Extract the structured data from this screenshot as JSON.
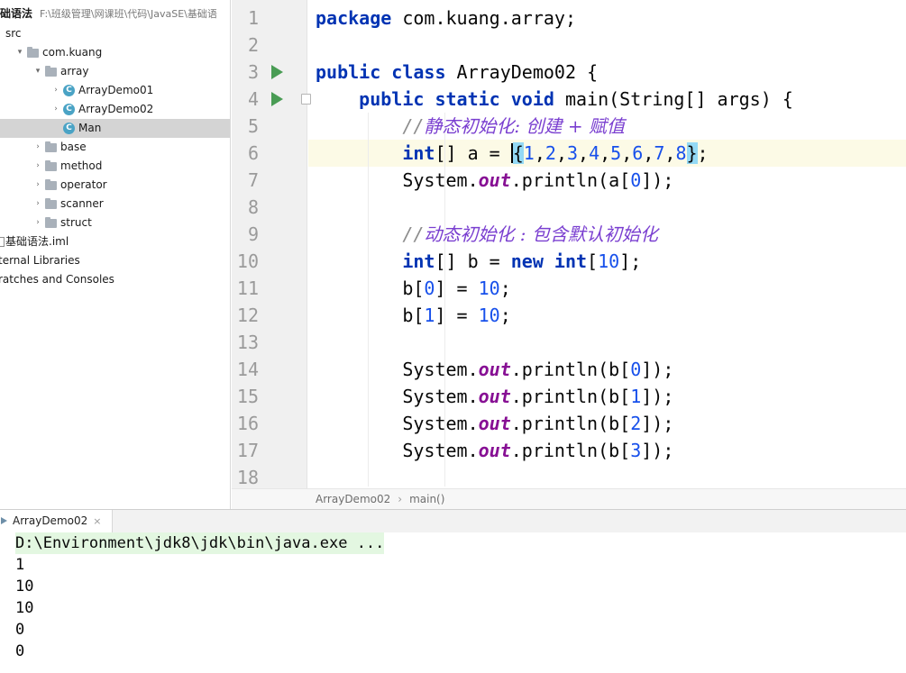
{
  "project": {
    "root_name": "础语法",
    "root_path": "F:\\班级管理\\网课班\\代码\\JavaSE\\基础语",
    "items": [
      {
        "label": "src",
        "type": "folder",
        "depth": 0,
        "expanded": true,
        "selected": false
      },
      {
        "label": "com.kuang",
        "type": "package",
        "depth": 1,
        "expanded": true,
        "selected": false
      },
      {
        "label": "array",
        "type": "package",
        "depth": 2,
        "expanded": true,
        "selected": false
      },
      {
        "label": "ArrayDemo01",
        "type": "class",
        "depth": 3,
        "expanded": false,
        "selected": false
      },
      {
        "label": "ArrayDemo02",
        "type": "class",
        "depth": 3,
        "expanded": false,
        "selected": false
      },
      {
        "label": "Man",
        "type": "class",
        "depth": 3,
        "expanded": false,
        "selected": true
      },
      {
        "label": "base",
        "type": "package",
        "depth": 2,
        "expanded": false,
        "selected": false
      },
      {
        "label": "method",
        "type": "package",
        "depth": 2,
        "expanded": false,
        "selected": false
      },
      {
        "label": "operator",
        "type": "package",
        "depth": 2,
        "expanded": false,
        "selected": false
      },
      {
        "label": "scanner",
        "type": "package",
        "depth": 2,
        "expanded": false,
        "selected": false
      },
      {
        "label": "struct",
        "type": "package",
        "depth": 2,
        "expanded": false,
        "selected": false
      },
      {
        "label": "基础语法.iml",
        "type": "iml",
        "depth": 0,
        "expanded": false,
        "selected": false
      },
      {
        "label": "ternal Libraries",
        "type": "node",
        "depth": 0,
        "expanded": false,
        "selected": false
      },
      {
        "label": "ratches and Consoles",
        "type": "node",
        "depth": 0,
        "expanded": false,
        "selected": false
      }
    ]
  },
  "editor": {
    "line_numbers": [
      "1",
      "2",
      "3",
      "4",
      "5",
      "6",
      "7",
      "8",
      "9",
      "10",
      "11",
      "12",
      "13",
      "14",
      "15",
      "16",
      "17",
      "18"
    ],
    "current_line": 6,
    "run_markers_on_lines": [
      3,
      4
    ],
    "fold_markers_on_lines": [
      4
    ],
    "lines": [
      [
        {
          "t": "package",
          "c": "kw"
        },
        {
          "t": " com.kuang.array;",
          "c": ""
        }
      ],
      [],
      [
        {
          "t": "public",
          "c": "kw"
        },
        {
          "t": " ",
          "c": ""
        },
        {
          "t": "class",
          "c": "kw"
        },
        {
          "t": " ArrayDemo02 {",
          "c": ""
        }
      ],
      [
        {
          "t": "    ",
          "c": ""
        },
        {
          "t": "public",
          "c": "kw"
        },
        {
          "t": " ",
          "c": ""
        },
        {
          "t": "static",
          "c": "kw"
        },
        {
          "t": " ",
          "c": ""
        },
        {
          "t": "void",
          "c": "kw"
        },
        {
          "t": " main(String[] args) {",
          "c": ""
        }
      ],
      [
        {
          "t": "        ",
          "c": ""
        },
        {
          "t": "//",
          "c": "cmt"
        },
        {
          "t": "静态初始化: 创建 + 赋值",
          "c": "cmt-zh"
        }
      ],
      [
        {
          "t": "        ",
          "c": ""
        },
        {
          "t": "int",
          "c": "kw"
        },
        {
          "t": "[] a = ",
          "c": ""
        },
        {
          "t": "",
          "c": "caret"
        },
        {
          "t": "{",
          "c": "brace-hl"
        },
        {
          "t": "1",
          "c": "num"
        },
        {
          "t": ",",
          "c": ""
        },
        {
          "t": "2",
          "c": "num"
        },
        {
          "t": ",",
          "c": ""
        },
        {
          "t": "3",
          "c": "num"
        },
        {
          "t": ",",
          "c": ""
        },
        {
          "t": "4",
          "c": "num"
        },
        {
          "t": ",",
          "c": ""
        },
        {
          "t": "5",
          "c": "num"
        },
        {
          "t": ",",
          "c": ""
        },
        {
          "t": "6",
          "c": "num"
        },
        {
          "t": ",",
          "c": ""
        },
        {
          "t": "7",
          "c": "num"
        },
        {
          "t": ",",
          "c": ""
        },
        {
          "t": "8",
          "c": "num"
        },
        {
          "t": "}",
          "c": "brace-hl"
        },
        {
          "t": ";",
          "c": ""
        }
      ],
      [
        {
          "t": "        System.",
          "c": ""
        },
        {
          "t": "out",
          "c": "fld"
        },
        {
          "t": ".println(a[",
          "c": ""
        },
        {
          "t": "0",
          "c": "num"
        },
        {
          "t": "]);",
          "c": ""
        }
      ],
      [],
      [
        {
          "t": "        ",
          "c": ""
        },
        {
          "t": "//",
          "c": "cmt"
        },
        {
          "t": "动态初始化 : 包含默认初始化",
          "c": "cmt-zh"
        }
      ],
      [
        {
          "t": "        ",
          "c": ""
        },
        {
          "t": "int",
          "c": "kw"
        },
        {
          "t": "[] b = ",
          "c": ""
        },
        {
          "t": "new",
          "c": "kw"
        },
        {
          "t": " ",
          "c": ""
        },
        {
          "t": "int",
          "c": "kw"
        },
        {
          "t": "[",
          "c": ""
        },
        {
          "t": "10",
          "c": "num"
        },
        {
          "t": "];",
          "c": ""
        }
      ],
      [
        {
          "t": "        b[",
          "c": ""
        },
        {
          "t": "0",
          "c": "num"
        },
        {
          "t": "] = ",
          "c": ""
        },
        {
          "t": "10",
          "c": "num"
        },
        {
          "t": ";",
          "c": ""
        }
      ],
      [
        {
          "t": "        b[",
          "c": ""
        },
        {
          "t": "1",
          "c": "num"
        },
        {
          "t": "] = ",
          "c": ""
        },
        {
          "t": "10",
          "c": "num"
        },
        {
          "t": ";",
          "c": ""
        }
      ],
      [],
      [
        {
          "t": "        System.",
          "c": ""
        },
        {
          "t": "out",
          "c": "fld"
        },
        {
          "t": ".println(b[",
          "c": ""
        },
        {
          "t": "0",
          "c": "num"
        },
        {
          "t": "]);",
          "c": ""
        }
      ],
      [
        {
          "t": "        System.",
          "c": ""
        },
        {
          "t": "out",
          "c": "fld"
        },
        {
          "t": ".println(b[",
          "c": ""
        },
        {
          "t": "1",
          "c": "num"
        },
        {
          "t": "]);",
          "c": ""
        }
      ],
      [
        {
          "t": "        System.",
          "c": ""
        },
        {
          "t": "out",
          "c": "fld"
        },
        {
          "t": ".println(b[",
          "c": ""
        },
        {
          "t": "2",
          "c": "num"
        },
        {
          "t": "]);",
          "c": ""
        }
      ],
      [
        {
          "t": "        System.",
          "c": ""
        },
        {
          "t": "out",
          "c": "fld"
        },
        {
          "t": ".println(b[",
          "c": ""
        },
        {
          "t": "3",
          "c": "num"
        },
        {
          "t": "]);",
          "c": ""
        }
      ],
      []
    ],
    "breadcrumb": [
      "ArrayDemo02",
      "main()"
    ]
  },
  "run": {
    "tab_label": "ArrayDemo02",
    "tab_close": "×",
    "command": "D:\\Environment\\jdk8\\jdk\\bin\\java.exe ...",
    "output": [
      "1",
      "10",
      "10",
      "0",
      "0"
    ]
  },
  "colors": {
    "keyword": "#0033b3",
    "number": "#1750eb",
    "static_field": "#871094",
    "comment": "#7a3fd0",
    "current_line_bg": "#fcfae6",
    "brace_match_bg": "#93d9f5",
    "run_marker": "#499c54",
    "selected_row_bg": "#d4d4d4"
  }
}
